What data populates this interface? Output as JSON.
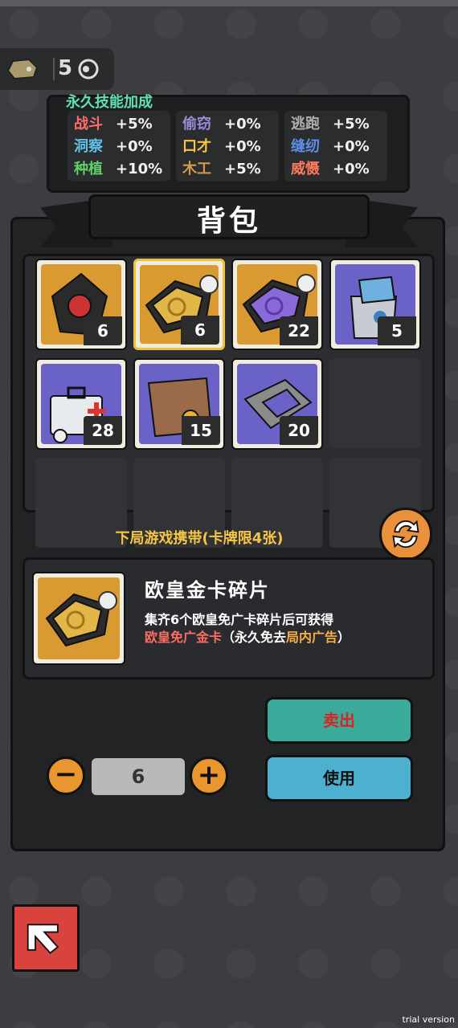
{
  "currency": {
    "value": "5",
    "icon": "ore-rock-icon",
    "icon2": "token-coin-icon"
  },
  "skills": {
    "title": "永久技能加成",
    "items": [
      {
        "name": "战斗",
        "value": "+5%",
        "color": "#ff6d6d"
      },
      {
        "name": "洞察",
        "value": "+0%",
        "color": "#5fc2e8"
      },
      {
        "name": "种植",
        "value": "+10%",
        "color": "#5fd06a"
      },
      {
        "name": "偷窃",
        "value": "+0%",
        "color": "#9a8ad8"
      },
      {
        "name": "口才",
        "value": "+0%",
        "color": "#f5c544"
      },
      {
        "name": "木工",
        "value": "+5%",
        "color": "#d69a4d"
      },
      {
        "name": "逃跑",
        "value": "+5%",
        "color": "#b0b0b0"
      },
      {
        "name": "缝纫",
        "value": "+0%",
        "color": "#5f8fe8"
      },
      {
        "name": "威慑",
        "value": "+0%",
        "color": "#ff7a5a"
      }
    ]
  },
  "backpack": {
    "title": "背包",
    "items": [
      {
        "icon": "black-card-pack-icon",
        "bg": "gold",
        "count": "6"
      },
      {
        "icon": "gold-card-fragment-icon",
        "bg": "gold",
        "count": "6",
        "selected": true
      },
      {
        "icon": "purple-card-fragment-icon",
        "bg": "gold",
        "count": "22"
      },
      {
        "icon": "money-bag-icon",
        "bg": "purple",
        "count": "5"
      },
      {
        "icon": "medical-kit-icon",
        "bg": "purple",
        "count": "28"
      },
      {
        "icon": "parchment-map-icon",
        "bg": "purple",
        "count": "15"
      },
      {
        "icon": "slime-capsule-icon",
        "bg": "purple",
        "count": "20"
      }
    ]
  },
  "carry_label": "下局游戏携带(卡牌限4张)",
  "detail": {
    "name": "欧皇金卡碎片",
    "desc_line1": "集齐6个欧皇免广卡碎片后可获得",
    "desc_red": "欧皇免广金卡",
    "desc_mid": "（永久免去",
    "desc_orange": "局内广告",
    "desc_end": "）"
  },
  "quantity": {
    "value": "6",
    "minus": "−",
    "plus": "+"
  },
  "buttons": {
    "sell": "卖出",
    "use": "使用"
  },
  "watermark": "trial version"
}
